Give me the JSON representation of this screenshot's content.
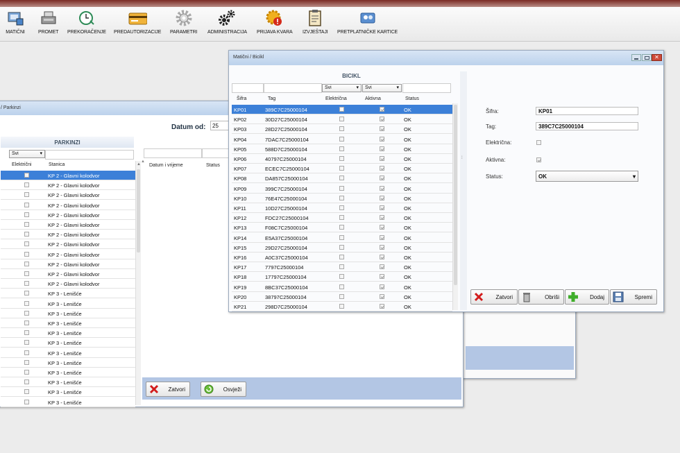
{
  "toolbar": {
    "items": [
      {
        "label": "MATIČNI",
        "icon": "master-data-icon"
      },
      {
        "label": "PROMET",
        "icon": "cash-register-icon"
      },
      {
        "label": "PREKORAČENJE",
        "icon": "clock-overdue-icon"
      },
      {
        "label": "PREDAUTORIZACIJE",
        "icon": "credit-card-icon"
      },
      {
        "label": "PARAMETRI",
        "icon": "gear-icon"
      },
      {
        "label": "ADMINISTRACIJA",
        "icon": "gears-icon"
      },
      {
        "label": "PRIJAVA KVARA",
        "icon": "warning-gear-icon"
      },
      {
        "label": "IZVJEŠTAJI",
        "icon": "report-clipboard-icon"
      },
      {
        "label": "PRETPLATNIČKE KARTICE",
        "icon": "subscriber-cards-icon"
      }
    ]
  },
  "parkinzi": {
    "title": "/ Parkinzi",
    "date_label": "Datum od:",
    "date_value": "25",
    "header": "PARKINZI",
    "filter": "Svi",
    "columns": [
      "Električni",
      "Stanica"
    ],
    "right_columns": [
      "Datum i vrijeme",
      "Status"
    ],
    "rows": [
      "KP 2 - Glavni kolodvor",
      "KP 2 - Glavni kolodvor",
      "KP 2 - Glavni kolodvor",
      "KP 2 - Glavni kolodvor",
      "KP 2 - Glavni kolodvor",
      "KP 2 - Glavni kolodvor",
      "KP 2 - Glavni kolodvor",
      "KP 2 - Glavni kolodvor",
      "KP 2 - Glavni kolodvor",
      "KP 2 - Glavni kolodvor",
      "KP 2 - Glavni kolodvor",
      "KP 2 - Glavni kolodvor",
      "KP 3 - Lenišće",
      "KP 3 - Lenišće",
      "KP 3 - Lenišće",
      "KP 3 - Lenišće",
      "KP 3 - Lenišće",
      "KP 3 - Lenišće",
      "KP 3 - Lenišće",
      "KP 3 - Lenišće",
      "KP 3 - Lenišće",
      "KP 3 - Lenišće",
      "KP 3 - Lenišće",
      "KP 3 - Lenišće"
    ],
    "close_label": "Zatvori",
    "refresh_label": "Osvježi"
  },
  "bicikl": {
    "title": "Matični / Bicikl",
    "header": "BICIKL",
    "filter1": "Svi",
    "filter2": "Svi",
    "columns": [
      "Šifra",
      "Tag",
      "Električna",
      "Aktivna",
      "Status"
    ],
    "rows": [
      {
        "sifra": "KP01",
        "tag": "389C7C25000104",
        "elek": false,
        "akt": true,
        "status": "OK"
      },
      {
        "sifra": "KP02",
        "tag": "30D27C25000104",
        "elek": false,
        "akt": true,
        "status": "OK"
      },
      {
        "sifra": "KP03",
        "tag": "28D27C25000104",
        "elek": false,
        "akt": true,
        "status": "OK"
      },
      {
        "sifra": "KP04",
        "tag": "7DAC7C25000104",
        "elek": false,
        "akt": true,
        "status": "OK"
      },
      {
        "sifra": "KP05",
        "tag": "588D7C25000104",
        "elek": false,
        "akt": true,
        "status": "OK"
      },
      {
        "sifra": "KP06",
        "tag": "40797C25000104",
        "elek": false,
        "akt": true,
        "status": "OK"
      },
      {
        "sifra": "KP07",
        "tag": "ECEC7C25000104",
        "elek": false,
        "akt": true,
        "status": "OK"
      },
      {
        "sifra": "KP08",
        "tag": "DA857C25000104",
        "elek": false,
        "akt": true,
        "status": "OK"
      },
      {
        "sifra": "KP09",
        "tag": "399C7C25000104",
        "elek": false,
        "akt": true,
        "status": "OK"
      },
      {
        "sifra": "KP10",
        "tag": "76E47C25000104",
        "elek": false,
        "akt": true,
        "status": "OK"
      },
      {
        "sifra": "KP11",
        "tag": "10D27C25000104",
        "elek": false,
        "akt": true,
        "status": "OK"
      },
      {
        "sifra": "KP12",
        "tag": "FDC27C25000104",
        "elek": false,
        "akt": true,
        "status": "OK"
      },
      {
        "sifra": "KP13",
        "tag": "F08C7C25000104",
        "elek": false,
        "akt": true,
        "status": "OK"
      },
      {
        "sifra": "KP14",
        "tag": "E5A37C25000104",
        "elek": false,
        "akt": true,
        "status": "OK"
      },
      {
        "sifra": "KP15",
        "tag": "29D27C25000104",
        "elek": false,
        "akt": true,
        "status": "OK"
      },
      {
        "sifra": "KP16",
        "tag": "A0C37C25000104",
        "elek": false,
        "akt": true,
        "status": "OK"
      },
      {
        "sifra": "KP17",
        "tag": "7797C25000104",
        "elek": false,
        "akt": true,
        "status": "OK"
      },
      {
        "sifra": "KP18",
        "tag": "17797C25000104",
        "elek": false,
        "akt": true,
        "status": "OK"
      },
      {
        "sifra": "KP19",
        "tag": "8BC37C25000104",
        "elek": false,
        "akt": true,
        "status": "OK"
      },
      {
        "sifra": "KP20",
        "tag": "38797C25000104",
        "elek": false,
        "akt": true,
        "status": "OK"
      },
      {
        "sifra": "KP21",
        "tag": "298D7C25000104",
        "elek": false,
        "akt": true,
        "status": "OK"
      }
    ],
    "form": {
      "sifra_label": "Šifra:",
      "sifra_value": "KP01",
      "tag_label": "Tag:",
      "tag_value": "389C7C25000104",
      "elek_label": "Električna:",
      "elek_checked": false,
      "akt_label": "Aktivna:",
      "akt_checked": true,
      "status_label": "Status:",
      "status_value": "OK"
    },
    "buttons": {
      "close": "Zatvori",
      "delete": "Obriši",
      "add": "Dodaj",
      "save": "Spremi"
    }
  },
  "colors": {
    "selection": "#3c80d8",
    "panel": "#b3c6e4",
    "title": "#bcd2ec"
  }
}
